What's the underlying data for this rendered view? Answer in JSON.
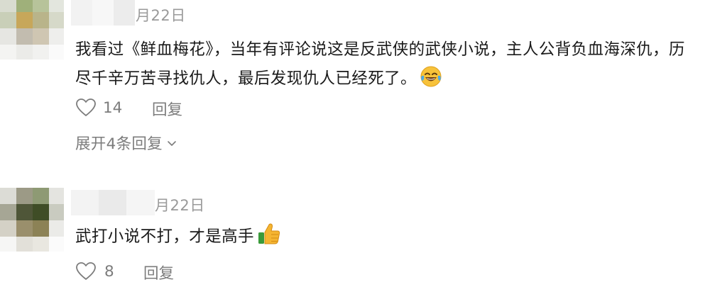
{
  "comments": [
    {
      "date": "月22日",
      "lines": [
        "我看过《鲜血梅花》，当年有评论说这是反武侠的武侠小说，主人公背负血海深仇，历",
        "尽千辛万苦寻找仇人，最后发现仇人已经死了。"
      ],
      "emoji": "laughing-tears-emoji",
      "likes": "14",
      "reply_label": "回复",
      "expand_label": "展开4条回复"
    },
    {
      "date": "月22日",
      "lines": [
        "武打小说不打，才是高手"
      ],
      "emoji": "thumbs-up-emoji",
      "likes": "8",
      "reply_label": "回复"
    }
  ],
  "colors": {
    "text": "#1a1a1a",
    "secondary": "#7c7c7c",
    "date": "#9a9a9a"
  },
  "icons": [
    "heart-icon",
    "chevron-down-icon"
  ]
}
